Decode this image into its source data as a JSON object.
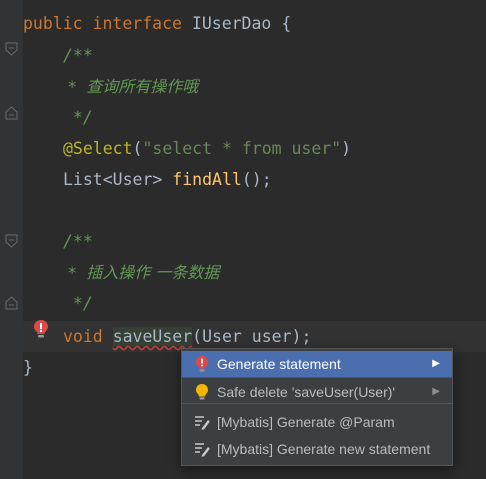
{
  "code": {
    "line1": {
      "kw1": "public",
      "kw2": "interface",
      "name": "IUserDao",
      "brace": "{"
    },
    "line2": {
      "text": "/**"
    },
    "line3": {
      "text": " *  查询所有操作哦"
    },
    "line4": {
      "text": " */"
    },
    "line5": {
      "annotation": "@Select",
      "paren_open": "(",
      "string": "\"select * from user\"",
      "paren_close": ")"
    },
    "line6": {
      "type": "List<User>",
      "method": "findAll",
      "rest": "();"
    },
    "line8": {
      "text": "/**"
    },
    "line9": {
      "text": " *  插入操作 一条数据"
    },
    "line10": {
      "text": " */"
    },
    "line11": {
      "kw": "void",
      "method": "saveUser",
      "rest": "(User user);"
    },
    "line12": {
      "text": "}"
    }
  },
  "popup": {
    "items": [
      {
        "label": "Generate statement",
        "icon": "red-bulb-icon",
        "submenu": "▶"
      },
      {
        "label": "Safe delete 'saveUser(User)'",
        "icon": "yellow-bulb-icon",
        "submenu": "▶"
      },
      {
        "label": "[Mybatis] Generate @Param",
        "icon": "mybatis-intention-icon"
      },
      {
        "label": "[Mybatis] Generate new statement",
        "icon": "mybatis-intention-icon"
      }
    ]
  },
  "colors": {
    "background": "#2b2b2b",
    "keyword": "#cc7832",
    "comment": "#629755",
    "annotation": "#bbb529",
    "string": "#6a8759",
    "method": "#ffc66d",
    "selection": "#4b6eaf"
  }
}
